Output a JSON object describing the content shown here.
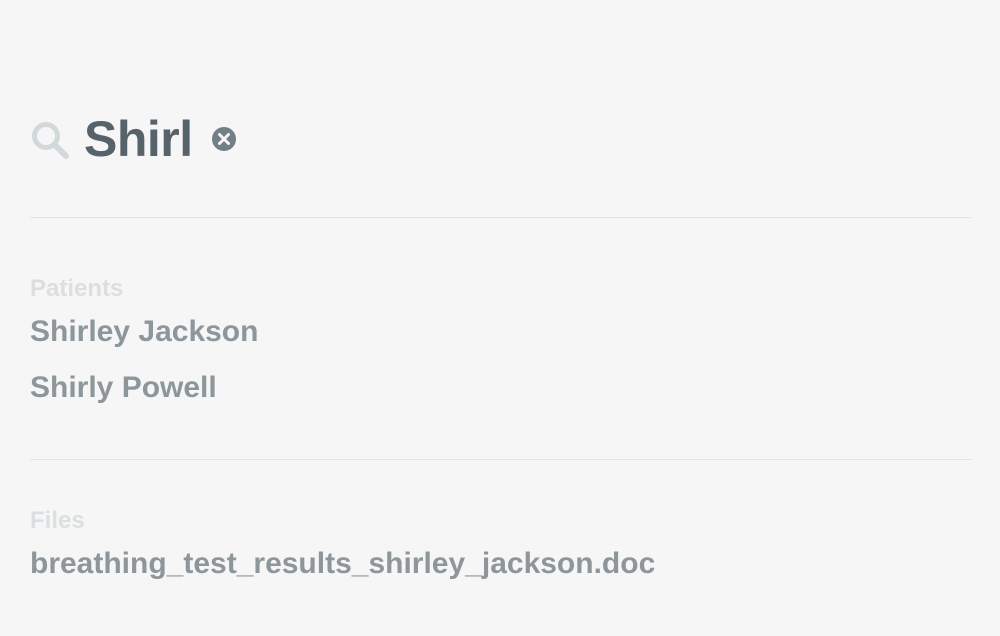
{
  "search": {
    "query": "Shirl",
    "search_icon": "search-icon",
    "clear_icon": "clear-circle-icon"
  },
  "sections": {
    "patients": {
      "label": "Patients",
      "items": [
        "Shirley Jackson",
        "Shirly Powell"
      ]
    },
    "files": {
      "label": "Files",
      "items": [
        "breathing_test_results_shirley_jackson.doc"
      ]
    }
  },
  "colors": {
    "background": "#f6f6f6",
    "query_text": "#56636a",
    "result_text": "#8d979b",
    "section_label": "#dcdfe1",
    "icon_muted": "#d3d8db",
    "clear_icon": "#727f85",
    "divider": "#e4e4e4"
  }
}
